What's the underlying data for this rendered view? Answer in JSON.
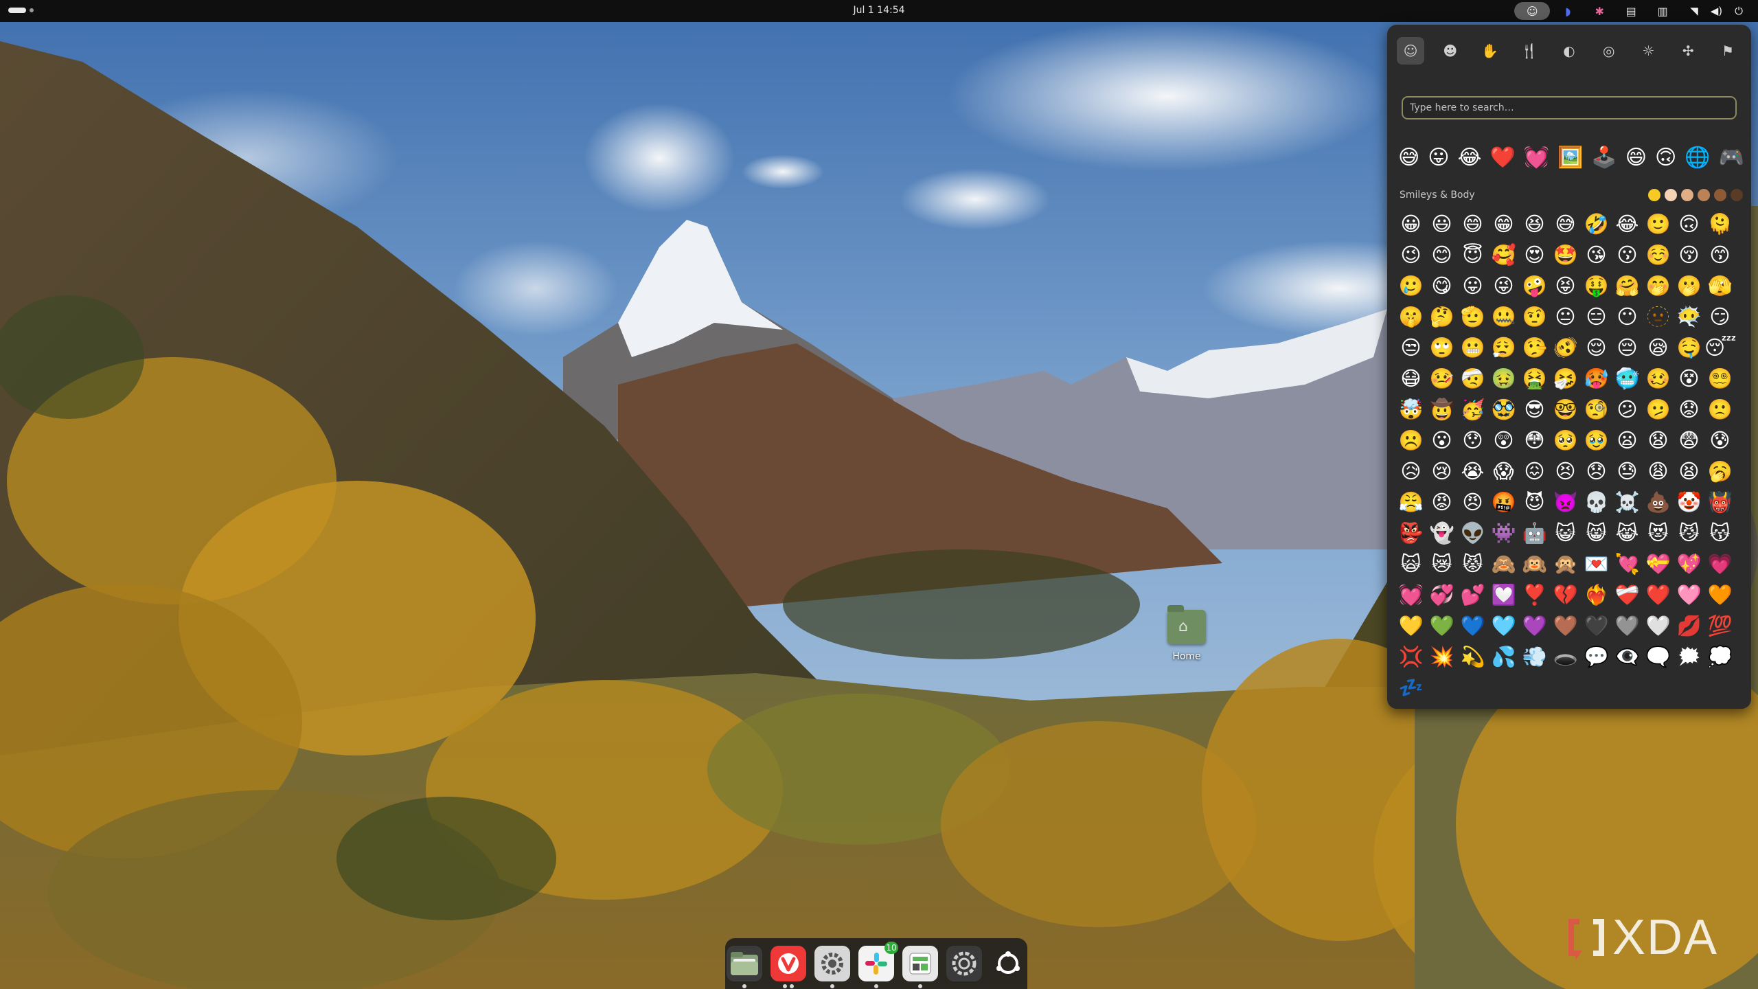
{
  "topbar": {
    "date": "Jul 1",
    "time": "14:54",
    "tray_icons": [
      "emoji-picker-icon",
      "app-indicator-icon",
      "extension-icon",
      "clipboard-icon",
      "tiling-icon"
    ],
    "system_icons": [
      "wifi-icon",
      "volume-icon",
      "power-icon"
    ]
  },
  "desktop": {
    "home_label": "Home"
  },
  "dock": {
    "apps": [
      {
        "name": "files",
        "icon": "📁"
      },
      {
        "name": "vivaldi",
        "icon": "🟥"
      },
      {
        "name": "settings-tweaks",
        "icon": "⚙"
      },
      {
        "name": "slack",
        "icon": "✳",
        "badge": "10"
      },
      {
        "name": "system-monitor",
        "icon": "▦"
      },
      {
        "name": "system-settings",
        "icon": "⚙"
      },
      {
        "name": "app-grid",
        "icon": "◯"
      }
    ]
  },
  "picker": {
    "categories": [
      {
        "name": "recent",
        "glyph": "☺"
      },
      {
        "name": "smileys",
        "glyph": "☻"
      },
      {
        "name": "people",
        "glyph": "✋"
      },
      {
        "name": "food",
        "glyph": "🍴"
      },
      {
        "name": "travel",
        "glyph": "◐"
      },
      {
        "name": "activities",
        "glyph": "◎"
      },
      {
        "name": "objects",
        "glyph": "☼"
      },
      {
        "name": "symbols",
        "glyph": "✣"
      },
      {
        "name": "flags",
        "glyph": "⚑"
      }
    ],
    "search_placeholder": "Type here to search…",
    "recent": [
      "😅",
      "😛",
      "😂",
      "❤️",
      "💓",
      "🖼️",
      "🕹️",
      "😄",
      "🙃",
      "🌐",
      "🎮"
    ],
    "section_title": "Smileys & Body",
    "skin_tones": [
      "#f6c924",
      "#f4d4b4",
      "#e0ad84",
      "#bb8258",
      "#8f5b37",
      "#5a3b26"
    ],
    "emojis": [
      "😀",
      "😃",
      "😄",
      "😁",
      "😆",
      "😅",
      "🤣",
      "😂",
      "🙂",
      "🙃",
      "🫠",
      "😉",
      "😊",
      "😇",
      "🥰",
      "😍",
      "🤩",
      "😘",
      "😗",
      "☺️",
      "😚",
      "😙",
      "🥲",
      "😋",
      "😛",
      "😜",
      "🤪",
      "😝",
      "🤑",
      "🤗",
      "🤭",
      "🫢",
      "🫣",
      "🤫",
      "🤔",
      "🫡",
      "🤐",
      "🤨",
      "😐",
      "😑",
      "😶",
      "🫥",
      "😶‍🌫️",
      "😏",
      "😒",
      "🙄",
      "😬",
      "😮‍💨",
      "🤥",
      "🫨",
      "😌",
      "😔",
      "😪",
      "🤤",
      "😴",
      "😷",
      "🤒",
      "🤕",
      "🤢",
      "🤮",
      "🤧",
      "🥵",
      "🥶",
      "🥴",
      "😵",
      "😵‍💫",
      "🤯",
      "🤠",
      "🥳",
      "🥸",
      "😎",
      "🤓",
      "🧐",
      "😕",
      "🫤",
      "😟",
      "🙁",
      "☹️",
      "😮",
      "😯",
      "😲",
      "😳",
      "🥺",
      "🥹",
      "😦",
      "😧",
      "😨",
      "😰",
      "😥",
      "😢",
      "😭",
      "😱",
      "😖",
      "😣",
      "😞",
      "😓",
      "😩",
      "😫",
      "🥱",
      "😤",
      "😡",
      "😠",
      "🤬",
      "😈",
      "👿",
      "💀",
      "☠️",
      "💩",
      "🤡",
      "👹",
      "👺",
      "👻",
      "👽",
      "👾",
      "🤖",
      "😺",
      "😸",
      "😹",
      "😻",
      "😼",
      "😽",
      "🙀",
      "😿",
      "😾",
      "🙈",
      "🙉",
      "🙊",
      "💌",
      "💘",
      "💝",
      "💖",
      "💗",
      "💓",
      "💞",
      "💕",
      "💟",
      "❣️",
      "💔",
      "❤️‍🔥",
      "❤️‍🩹",
      "❤️",
      "🩷",
      "🧡",
      "💛",
      "💚",
      "💙",
      "🩵",
      "💜",
      "🤎",
      "🖤",
      "🩶",
      "🤍",
      "💋",
      "💯",
      "💢",
      "💥",
      "💫",
      "💦",
      "💨",
      "🕳️",
      "💬",
      "👁️‍🗨️",
      "🗨️",
      "🗯️",
      "💭",
      "💤"
    ]
  },
  "watermark": {
    "text": "XDA"
  }
}
